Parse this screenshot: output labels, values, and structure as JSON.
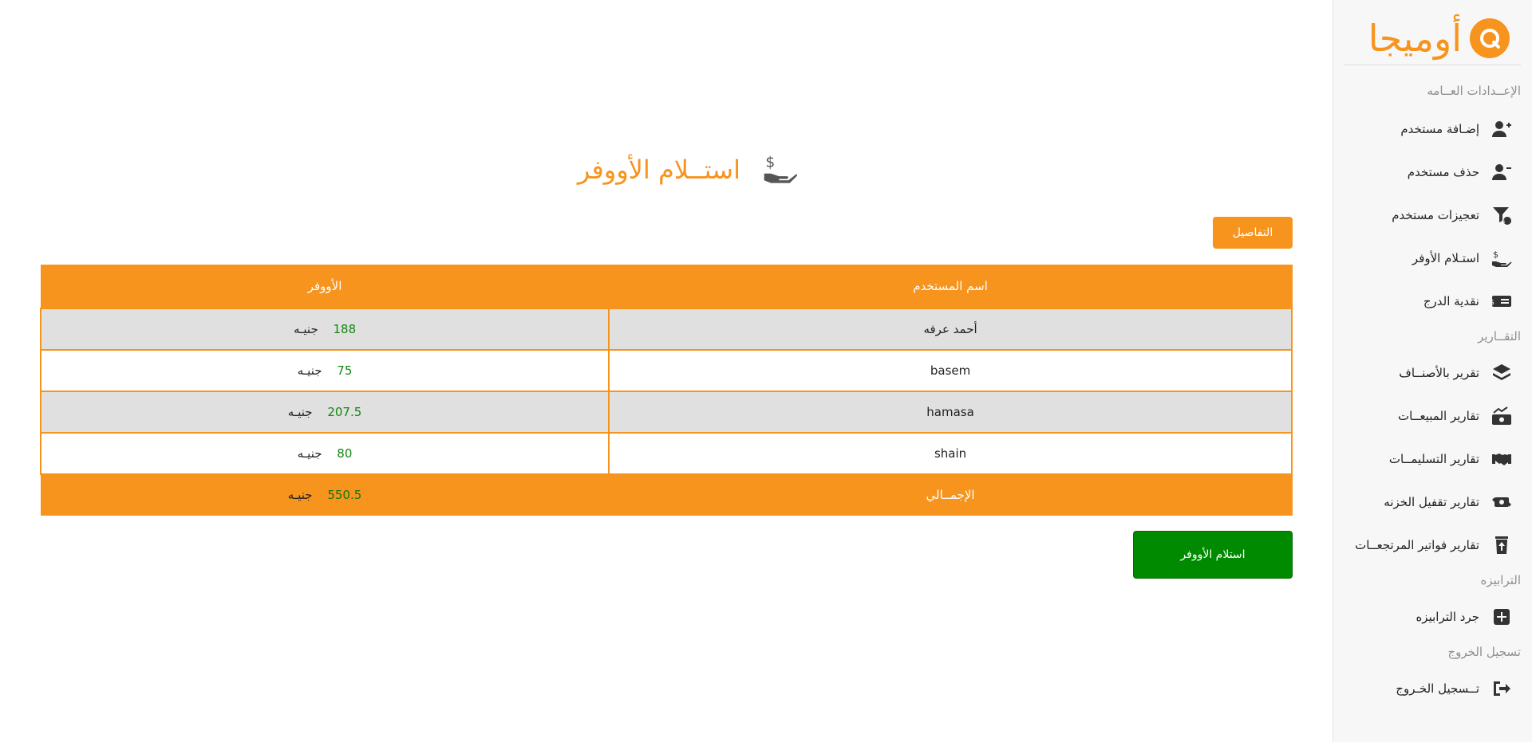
{
  "brand": {
    "name": "أوميجا"
  },
  "sidebar": {
    "sections": [
      {
        "label": "الإعــدادات العــامه"
      },
      {
        "label": "التقــارير"
      },
      {
        "label": "الترابيزه"
      },
      {
        "label": "تسجيل الخروج"
      }
    ],
    "items": [
      {
        "label": "إضـافة مستخدم",
        "icon": "user-plus-icon"
      },
      {
        "label": "حذف مستخدم",
        "icon": "user-minus-icon"
      },
      {
        "label": "تعجيزات مستخدم",
        "icon": "filter-dollar-icon"
      },
      {
        "label": "استـلام الأوفر",
        "icon": "hand-holding-dollar-icon"
      },
      {
        "label": "نقدية الدرج",
        "icon": "money-bill-icon"
      },
      {
        "label": "تقرير بالأصنــاف",
        "icon": "layers-icon"
      },
      {
        "label": "تقارير المبيعــات",
        "icon": "money-trend-icon"
      },
      {
        "label": "تقارير التسليمــات",
        "icon": "handshake-icon"
      },
      {
        "label": "تقارير تقفيل الخزنه",
        "icon": "money-exchange-icon"
      },
      {
        "label": "تقارير فواتير المرتجعــات",
        "icon": "trash-arrow-icon"
      },
      {
        "label": "جرد الترابيزه",
        "icon": "plus-square-icon"
      },
      {
        "label": "تــسجيل الخـروج",
        "icon": "sign-out-icon"
      }
    ]
  },
  "main": {
    "title": "استــلام الأووفر",
    "details_button": "التفاصيل",
    "table": {
      "headers": {
        "user": "اسم المستخدم",
        "over": "الأووفر"
      },
      "rows": [
        {
          "user": "أحمد عرفه",
          "amount": "188",
          "currency": "جنيـه"
        },
        {
          "user": "basem",
          "amount": "75",
          "currency": "جنيـه"
        },
        {
          "user": "hamasa",
          "amount": "207.5",
          "currency": "جنيـه"
        },
        {
          "user": "shain",
          "amount": "80",
          "currency": "جنيـه"
        }
      ],
      "total": {
        "label": "الإجمــالي",
        "amount": "550.5",
        "currency": "جنيـه"
      }
    },
    "receive_button": "استلام الأووفر"
  },
  "colors": {
    "accent": "#f7941d",
    "success": "#008a00",
    "row_alt": "#e0e0e0"
  }
}
